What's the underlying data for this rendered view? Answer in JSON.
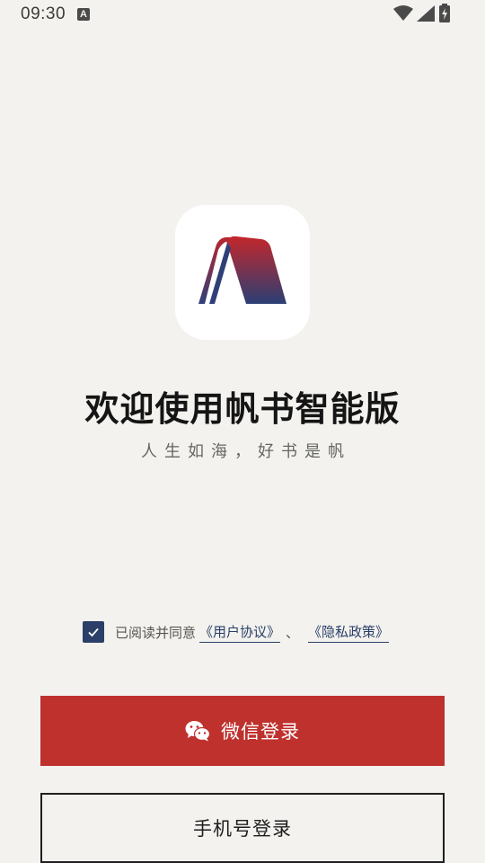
{
  "status_bar": {
    "time": "09:30",
    "notification_icon": "a-icon",
    "icons": [
      "wifi-icon",
      "signal-icon",
      "battery-charging-icon"
    ]
  },
  "app": {
    "title": "欢迎使用帆书智能版",
    "subtitle": "人生如海，好书是帆"
  },
  "agreement": {
    "checked": true,
    "prefix": "已阅读并同意",
    "user_agreement": "《用户协议》",
    "separator": "、",
    "privacy_policy": "《隐私政策》"
  },
  "buttons": {
    "wechat_login": "微信登录",
    "phone_login": "手机号登录"
  },
  "colors": {
    "background": "#f3f2ee",
    "primary_red": "#bf312d",
    "navy": "#2a4069"
  }
}
